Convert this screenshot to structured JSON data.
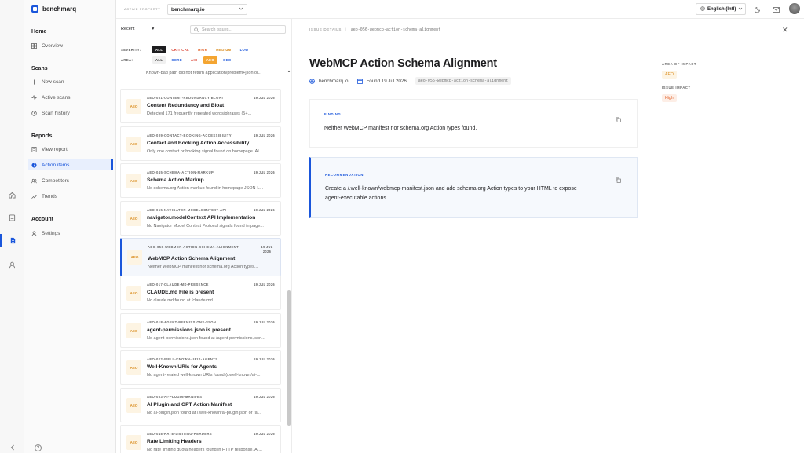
{
  "app": {
    "brand": "benchmarq"
  },
  "nav": {
    "sections": [
      {
        "title": "Home",
        "items": [
          {
            "label": "Overview",
            "icon": "grid-icon"
          }
        ]
      },
      {
        "title": "Scans",
        "items": [
          {
            "label": "New scan",
            "icon": "plus-icon"
          },
          {
            "label": "Active scans",
            "icon": "activity-icon"
          },
          {
            "label": "Scan history",
            "icon": "history-icon"
          }
        ]
      },
      {
        "title": "Reports",
        "items": [
          {
            "label": "View report",
            "icon": "document-icon"
          },
          {
            "label": "Action items",
            "icon": "info-icon",
            "active": true
          },
          {
            "label": "Competitors",
            "icon": "users-icon"
          },
          {
            "label": "Trends",
            "icon": "trend-icon"
          }
        ]
      },
      {
        "title": "Account",
        "items": [
          {
            "label": "Settings",
            "icon": "user-icon"
          }
        ]
      }
    ]
  },
  "topbar": {
    "active_property_label": "ACTIVE PROPERTY",
    "active_property": "benchmarq.io",
    "language": "English (Intl)"
  },
  "list": {
    "sort": "Recent",
    "search_placeholder": "Search issues...",
    "severity_label": "SEVERITY:",
    "severity": [
      "ALL",
      "CRITICAL",
      "HIGH",
      "MEDIUM",
      "LOW"
    ],
    "area_label": "AREA:",
    "area": [
      "ALL",
      "CORE",
      "AIO",
      "AEO",
      "GEO"
    ],
    "partial_desc": "Known-bad path did not return application/problem+json or...",
    "items": [
      {
        "badge": "AEO",
        "id": "AEO-031-CONTENT-REDUNDANCY-BLOAT",
        "date": "19 JUL 2026",
        "title": "Content Redundancy and Bloat",
        "desc": "Detected 171 frequently repeated words/phrases (5+..."
      },
      {
        "badge": "AEO",
        "id": "AEO-039-CONTACT-BOOKING-ACCESSIBILITY",
        "date": "19 JUL 2026",
        "title": "Contact and Booking Action Accessibility",
        "desc": "Only one contact or booking signal found on homepage. AI..."
      },
      {
        "badge": "AEO",
        "id": "AEO-045-SCHEMA-ACTION-MARKUP",
        "date": "19 JUL 2026",
        "title": "Schema Action Markup",
        "desc": "No schema.org Action markup found in homepage JSON-L..."
      },
      {
        "badge": "AEO",
        "id": "AEO-055-NAVIGATOR-MODELCONTEXT-API",
        "date": "19 JUL 2026",
        "title": "navigator.modelContext API Implementation",
        "desc": "No Navigator Model Context Protocol signals found in page..."
      },
      {
        "badge": "AEO",
        "id": "AEO-056-WEBMCP-ACTION-SCHEMA-ALIGNMENT",
        "date": "19 JUL 2026",
        "title": "WebMCP Action Schema Alignment",
        "desc": "Neither WebMCP manifest nor schema.org Action types...",
        "active": true
      },
      {
        "badge": "AEO",
        "id": "AEO-017-CLAUDE-MD-PRESENCE",
        "date": "19 JUL 2026",
        "title": "CLAUDE.md File is present",
        "desc": "No claude.md found at /claude.md."
      },
      {
        "badge": "AEO",
        "id": "AEO-018-AGENT-PERMISSIONS-JSON",
        "date": "19 JUL 2026",
        "title": "agent-permissions.json is present",
        "desc": "No agent-permissions.json found at /agent-permissions.json..."
      },
      {
        "badge": "AEO",
        "id": "AEO-022-WELL-KNOWN-URIS-AGENTS",
        "date": "19 JUL 2026",
        "title": "Well-Known URIs for Agents",
        "desc": "No agent-related well-known URIs found (/.well-known/ai-..."
      },
      {
        "badge": "AEO",
        "id": "AEO-033-AI-PLUGIN-MANIFEST",
        "date": "19 JUL 2026",
        "title": "AI Plugin and GPT Action Manifest",
        "desc": "No ai-plugin.json found at /.well-known/ai-plugin.json or /ai..."
      },
      {
        "badge": "AEO",
        "id": "AEO-048-RATE-LIMITING-HEADERS",
        "date": "19 JUL 2026",
        "title": "Rate Limiting Headers",
        "desc": "No rate limiting quota headers found in HTTP response. AI..."
      }
    ]
  },
  "detail": {
    "header_label": "ISSUE DETAILS",
    "header_code": "aeo-056-webmcp-action-schema-alignment",
    "title": "WebMCP Action Schema Alignment",
    "site": "benchmarq.io",
    "found": "Found 19 Jul 2026",
    "code_pill": "aeo-056-webmcp-action-schema-alignment",
    "finding_label": "FINDING",
    "finding": "Neither WebMCP manifest nor schema.org Action types found.",
    "recommendation_label": "RECOMMENDATION",
    "recommendation_line1": "Create a /.well-known/webmcp-manifest.json and add schema.org Action types to your HTML to expose",
    "recommendation_line2": "agent-executable actions.",
    "area_label": "AREA OF IMPACT",
    "area": "AEO",
    "impact_label": "ISSUE IMPACT",
    "impact": "High"
  },
  "colors": {
    "accent": "#1a56db",
    "aeo": "#d98a1a",
    "aeo_bg": "#fdf4e3",
    "critical": "#d93b2b",
    "high": "#e2622a",
    "medium": "#d98a1a",
    "low": "#1a56db",
    "core": "#1a56db",
    "aio": "#d93b2b",
    "geo": "#1a56db",
    "impact_high": "#e2622a",
    "impact_bg": "#fdeee6"
  }
}
